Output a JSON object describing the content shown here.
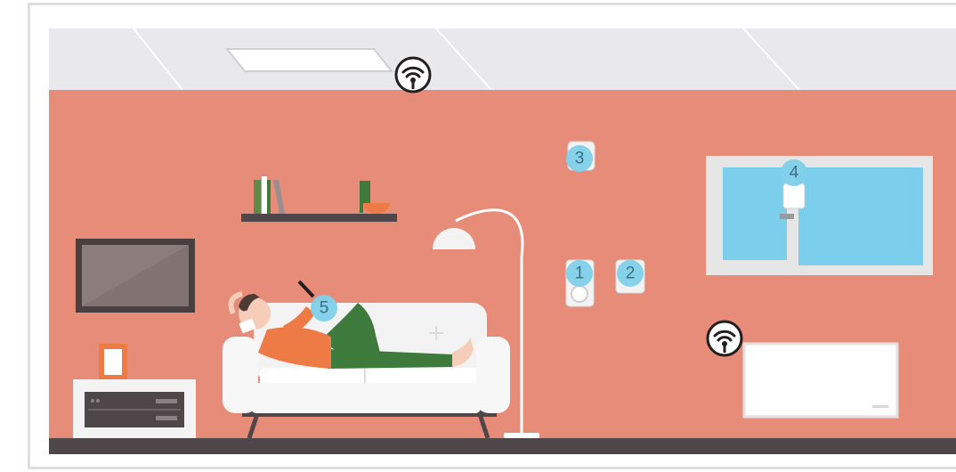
{
  "colors": {
    "wall": "#e88c7a",
    "ceiling": "#e9e9eb",
    "floor": "#4e4649",
    "badge": "#7fd0ea",
    "window_glass": "#7ccfec",
    "sofa": "#f3f3f3",
    "shirt": "#ee7a45",
    "pants": "#3f7a3d",
    "wifi": "#231f20"
  },
  "icons": {
    "wifi_ceiling": "wifi-icon",
    "wifi_wall": "wifi-icon"
  },
  "devices": [
    {
      "label": "1",
      "name": "wall-switch-with-sensor"
    },
    {
      "label": "2",
      "name": "wall-switch"
    },
    {
      "label": "3",
      "name": "wall-sensor"
    },
    {
      "label": "4",
      "name": "window-sensor"
    },
    {
      "label": "5",
      "name": "smartphone"
    }
  ]
}
